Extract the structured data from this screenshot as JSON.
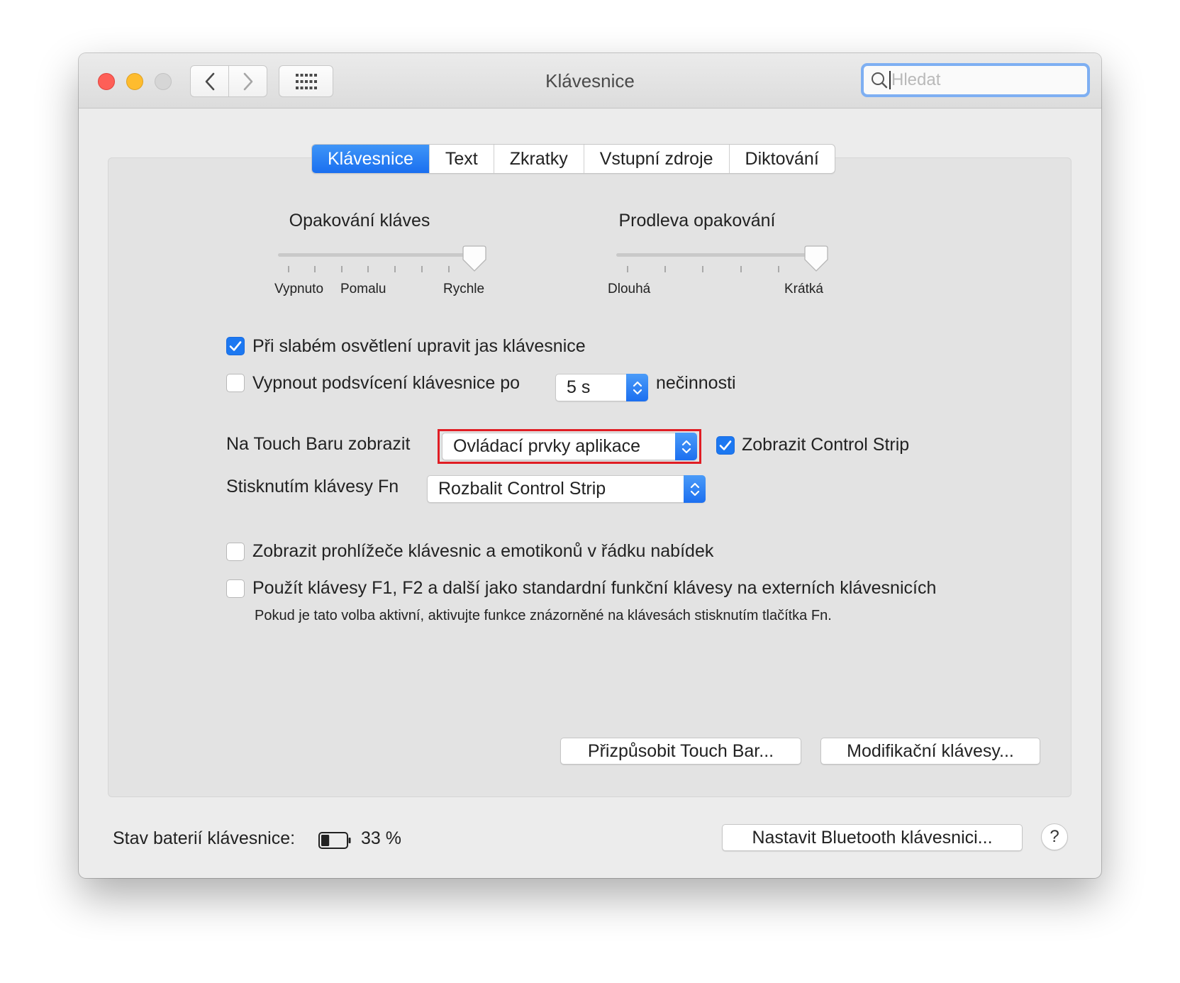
{
  "window": {
    "title": "Klávesnice"
  },
  "search": {
    "placeholder": "Hledat"
  },
  "tabs": [
    {
      "label": "Klávesnice",
      "active": true
    },
    {
      "label": "Text",
      "active": false
    },
    {
      "label": "Zkratky",
      "active": false
    },
    {
      "label": "Vstupní zdroje",
      "active": false
    },
    {
      "label": "Diktování",
      "active": false
    }
  ],
  "key_repeat": {
    "title": "Opakování kláves",
    "labels": [
      "Vypnuto",
      "Pomalu",
      "Rychle"
    ],
    "value_fraction": 1.0
  },
  "repeat_delay": {
    "title": "Prodleva opakování",
    "labels": [
      "Dlouhá",
      "Krátká"
    ],
    "value_fraction": 1.0
  },
  "options": {
    "adjust_brightness": {
      "label": "Při slabém osvětlení upravit jas klávesnice",
      "checked": true
    },
    "backlight_off": {
      "label": "Vypnout podsvícení klávesnice po",
      "checked": false,
      "value": "5 s",
      "suffix": "nečinnosti"
    },
    "touchbar": {
      "label": "Na Touch Baru zobrazit",
      "value": "Ovládací prvky aplikace"
    },
    "control_strip": {
      "label": "Zobrazit Control Strip",
      "checked": true
    },
    "fn_key": {
      "label": "Stisknutím klávesy Fn",
      "value": "Rozbalit Control Strip"
    },
    "show_viewers": {
      "label": "Zobrazit prohlížeče klávesnic a emotikonů v řádku nabídek",
      "checked": false
    },
    "function_keys": {
      "label": "Použít klávesy F1, F2 a další jako standardní funkční klávesy na externích klávesnicích",
      "checked": false,
      "note": "Pokud je tato volba aktivní, aktivujte funkce znázorněné na klávesách stisknutím tlačítka Fn."
    }
  },
  "buttons": {
    "customize_touchbar": "Přizpůsobit Touch Bar...",
    "modifier_keys": "Modifikační klávesy...",
    "bluetooth": "Nastavit Bluetooth klávesnici...",
    "help": "?"
  },
  "battery": {
    "label": "Stav baterií klávesnice:",
    "percent": "33 %",
    "level": 0.33
  },
  "colors": {
    "accent": "#1c78f1",
    "highlight": "#e01d24"
  }
}
